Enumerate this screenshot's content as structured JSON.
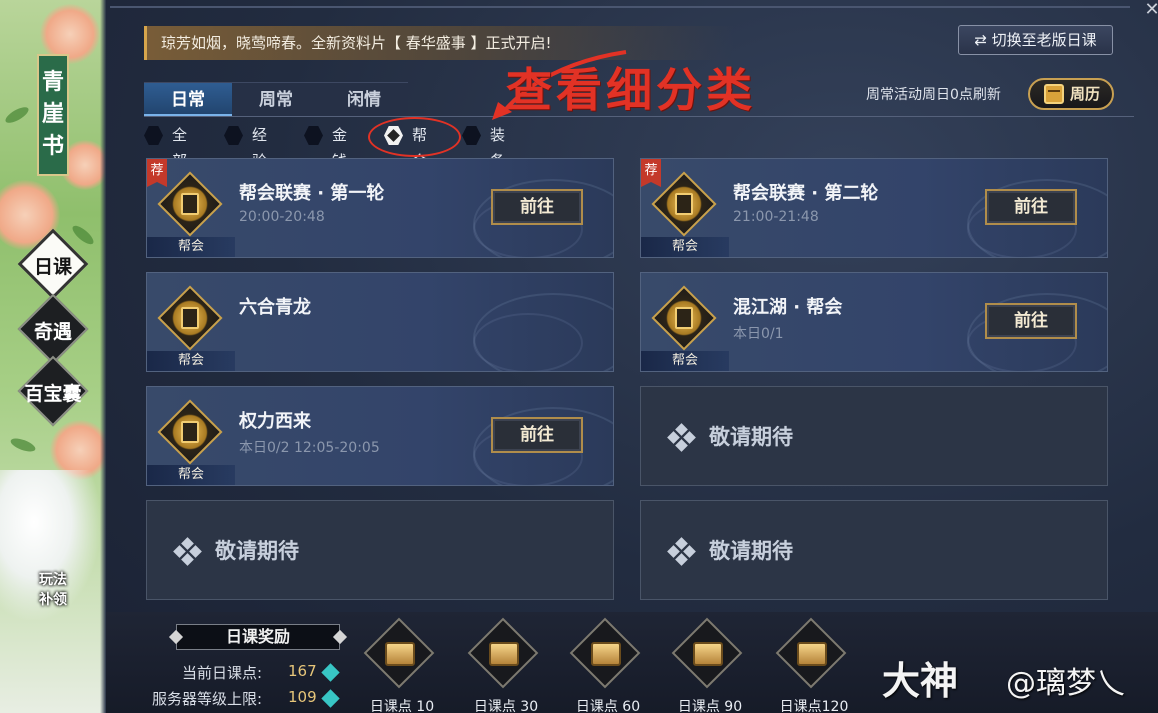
{
  "sidebar": {
    "book_title": "青崖书",
    "nav": [
      {
        "label": "日课",
        "active": true
      },
      {
        "label": "奇遇",
        "active": false
      },
      {
        "label": "百宝囊",
        "active": false
      }
    ],
    "play_label_1": "玩法",
    "play_label_2": "补领"
  },
  "header": {
    "notice": "琼芳如烟，晓莺啼春。全新资料片【 春华盛事 】正式开启!",
    "switch_old": "切换至老版日课",
    "refresh_note": "周常活动周日0点刷新",
    "week_calendar": "周历",
    "close": "✕"
  },
  "annotation": {
    "text": "查看细分类",
    "color": "#e23225"
  },
  "tabs": [
    {
      "label": "日常",
      "active": true
    },
    {
      "label": "周常",
      "active": false
    },
    {
      "label": "闲情",
      "active": false
    }
  ],
  "filters": [
    {
      "label": "全部",
      "active": false
    },
    {
      "label": "经验",
      "active": false
    },
    {
      "label": "金钱",
      "active": false
    },
    {
      "label": "帮会",
      "active": true
    },
    {
      "label": "装备",
      "active": false
    }
  ],
  "cards": [
    {
      "name": "帮会联赛 · 第一轮",
      "sub": "20:00-20:48",
      "tag": "帮会",
      "recommend": "荐",
      "button": "前往"
    },
    {
      "name": "帮会联赛 · 第二轮",
      "sub": "21:00-21:48",
      "tag": "帮会",
      "recommend": "荐",
      "button": "前往"
    },
    {
      "name": "六合青龙",
      "sub": "",
      "tag": "帮会",
      "recommend": "",
      "button": ""
    },
    {
      "name": "混江湖 · 帮会",
      "sub": "本日0/1",
      "tag": "帮会",
      "recommend": "",
      "button": "前往"
    },
    {
      "name": "权力西来",
      "sub": "本日0/2  12:05-20:05",
      "tag": "帮会",
      "recommend": "",
      "button": "前往"
    },
    {
      "coming_soon": "敬请期待"
    },
    {
      "coming_soon": "敬请期待"
    },
    {
      "coming_soon": "敬请期待"
    }
  ],
  "rewards": {
    "title": "日课奖励",
    "current_label": "当前日课点:",
    "current_value": "167",
    "server_label": "服务器等级上限:",
    "server_value": "109",
    "chests": [
      "日课点 10",
      "日课点 30",
      "日课点 60",
      "日课点 90",
      "日课点120"
    ]
  },
  "watermark": {
    "brand": "大神",
    "user": "@璃梦乀"
  },
  "colors": {
    "accent_gold": "#c8a052",
    "active_tab": "#2f5d92",
    "annotation_red": "#e23225"
  }
}
